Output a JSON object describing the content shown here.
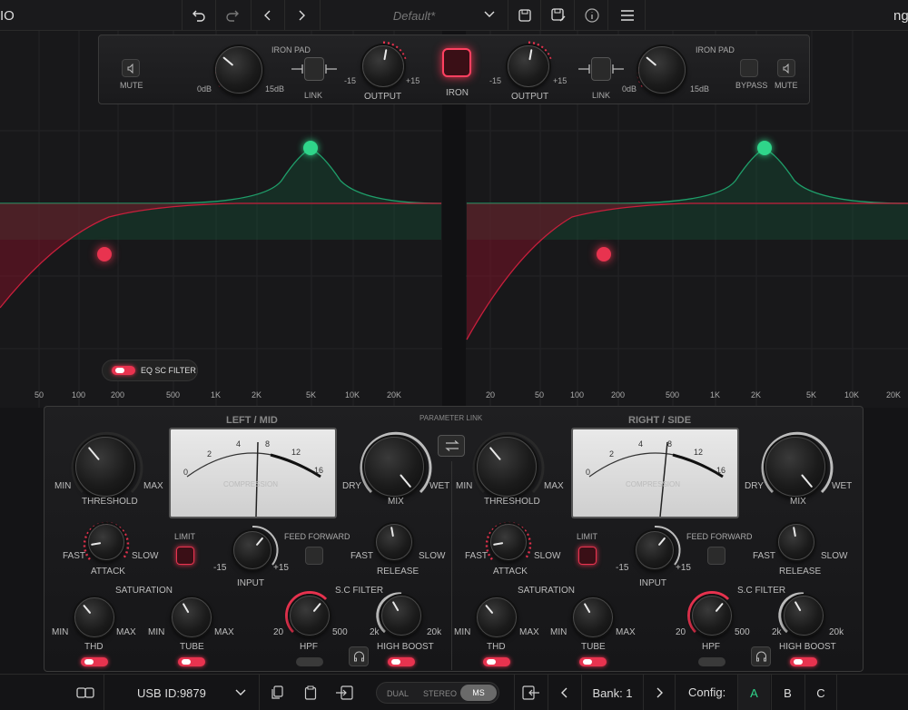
{
  "toolbar": {
    "brand_left": "IO",
    "brand_right": "ng",
    "preset": "Default*"
  },
  "top": {
    "mute": "MUTE",
    "iron_pad": "IRON PAD",
    "zero_db": "0dB",
    "fifteen_db": "15dB",
    "link": "LINK",
    "output": "OUTPUT",
    "minus15": "-15",
    "plus15": "+15",
    "iron": "IRON",
    "bypass": "BYPASS"
  },
  "eq": {
    "sc_filter": "EQ SC FILTER",
    "freq_left": [
      "50",
      "100",
      "200",
      "500",
      "1K",
      "2K",
      "5K",
      "10K",
      "20K"
    ],
    "freq_right": [
      "20",
      "50",
      "100",
      "200",
      "500",
      "1K",
      "2K",
      "5K",
      "10K",
      "20K"
    ]
  },
  "channels": {
    "left_title": "LEFT / MID",
    "right_title": "RIGHT / SIDE",
    "param_link": "PARAMETER LINK",
    "threshold": "THRESHOLD",
    "min": "MIN",
    "max": "MAX",
    "dry": "DRY",
    "wet": "WET",
    "mix": "MIX",
    "limit": "LIMIT",
    "feed_forward": "FEED FORWARD",
    "fast": "FAST",
    "slow": "SLOW",
    "attack": "ATTACK",
    "release": "RELEASE",
    "input": "INPUT",
    "minus15": "-15",
    "plus15": "+15",
    "saturation": "SATURATION",
    "thd": "THD",
    "tube": "TUBE",
    "sc_filter": "S.C FILTER",
    "hpf": "HPF",
    "high_boost": "HIGH BOOST",
    "hpf_min": "20",
    "hpf_max": "500",
    "hb_min": "2k",
    "hb_max": "20k",
    "meter_ticks": [
      "0",
      "2",
      "4",
      "8",
      "12",
      "16"
    ],
    "meter_label": "COMPRESSION"
  },
  "bottom": {
    "usb_id": "USB ID:9879",
    "dual": "DUAL",
    "stereo": "STEREO",
    "ms": "MS",
    "bank": "Bank: 1",
    "config": "Config:",
    "a": "A",
    "b": "B",
    "c": "C"
  }
}
